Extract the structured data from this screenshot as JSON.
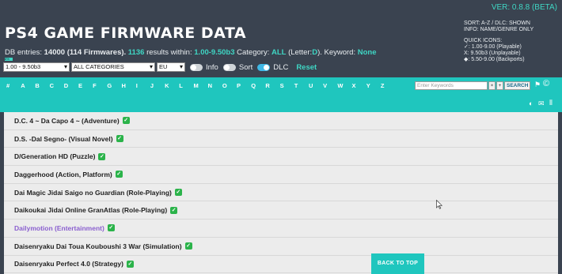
{
  "header": {
    "version": "VER: 0.8.8 (BETA)",
    "title": "PS4 GAME FIRMWARE DATA",
    "sort_info": "SORT: A-Z / DLC: SHOWN",
    "info_info": "INFO: NAME/GENRE ONLY",
    "quick_icons_label": "QUICK ICONS:",
    "icon_playable": "✓: 1.00-9.00 (Playable)",
    "icon_unplayable": "X: 9.50b3 (Unplayable)",
    "icon_backports": "◆: 5.50-9.00 (Backports)"
  },
  "stats": {
    "db_label": "DB entries:",
    "db_count": "14000 (114 Firmwares).",
    "results_count": "1136",
    "results_label": "results within:",
    "fw_range": "1.00-9.50b3",
    "category_label": "Category:",
    "category_value": "ALL",
    "letter_open": "(Letter:",
    "letter_value": "D",
    "letter_close": "). Keyword:",
    "keyword_value": "None",
    "progress_text": "8%"
  },
  "controls": {
    "firmware_select": "1.00 - 9.50b3",
    "category_select": "ALL CATEGORIES",
    "region_select": "EU",
    "info_label": "Info",
    "sort_label": "Sort",
    "dlc_label": "DLC",
    "reset_label": "Reset"
  },
  "nav": {
    "letters": [
      "#",
      "A",
      "B",
      "C",
      "D",
      "E",
      "F",
      "G",
      "H",
      "I",
      "J",
      "K",
      "L",
      "M",
      "N",
      "O",
      "P",
      "Q",
      "R",
      "S",
      "T",
      "U",
      "V",
      "W",
      "X",
      "Y",
      "Z"
    ],
    "search_placeholder": "Enter Keywords",
    "clear_label": "×",
    "add_label": "+",
    "search_label": "SEARCH"
  },
  "games": [
    {
      "name": "D.C. 4 ~ Da Capo 4 ~ (Adventure)",
      "visited": false
    },
    {
      "name": "D.S. -Dal Segno- (Visual Novel)",
      "visited": false
    },
    {
      "name": "D/Generation HD (Puzzle)",
      "visited": false
    },
    {
      "name": "Daggerhood (Action, Platform)",
      "visited": false
    },
    {
      "name": "Dai Magic Jidai Saigo no Guardian (Role-Playing)",
      "visited": false
    },
    {
      "name": "Daikoukai Jidai Online GranAtlas (Role-Playing)",
      "visited": false
    },
    {
      "name": "Dailymotion (Entertainment)",
      "visited": true
    },
    {
      "name": "Daisenryaku Dai Toua Kouboushi 3 War (Simulation)",
      "visited": false
    },
    {
      "name": "Daisenryaku Perfect 4.0 (Strategy)",
      "visited": false
    }
  ],
  "back_to_top": "BACK TO TOP",
  "colors": {
    "accent": "#1fc6be",
    "header_bg": "#3a4350",
    "highlight": "#3fd6c4",
    "check": "#2bb34a",
    "visited": "#8a5fcf"
  }
}
